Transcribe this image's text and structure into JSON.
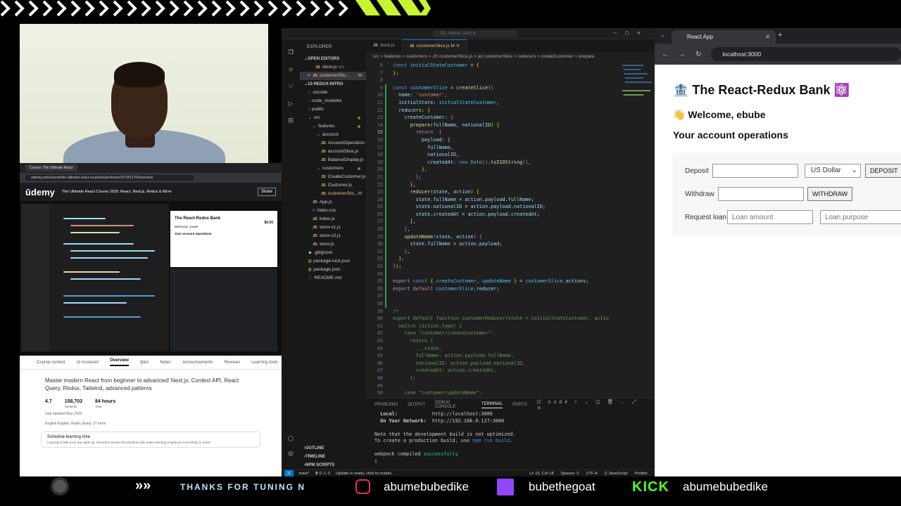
{
  "stream": {
    "ticker": "THANKS FOR TUNING",
    "ticker_tail": "N",
    "instagram": "abumebubedike",
    "twitch": "bubethegoat",
    "kick_label": "KICK",
    "kick": "abumebubedike"
  },
  "udemy": {
    "tab_title": "Course: The Ultimate React",
    "url": "udemy.com/course/the-ultimate-react-course/learn/lecture/37351170#overview",
    "logo": "ūdemy",
    "course_title": "The Ultimate React Course 2025: React, Next.js, Redux & More",
    "share": "Share",
    "mini_app_title": "The React-Redux Bank",
    "mini_app_amount": "$0.00",
    "mini_welcome": "Welcome, Jonas",
    "mini_ops": "Your account operations",
    "tabs": [
      "Course content",
      "AI Assistant",
      "Overview",
      "Q&A",
      "Notes",
      "Announcements",
      "Reviews",
      "Learning tools"
    ],
    "description": "Master modern React from beginner to advanced! Next.js, Context API, React Query, Redux, Tailwind, advanced patterns",
    "rating": "4.7",
    "students": "158,703",
    "students_label": "Students",
    "hours": "84 hours",
    "hours_label": "Total",
    "updated": "Last updated May 2025",
    "lang": "English   English, Arabic [Auto], 27 more",
    "schedule_title": "Schedule learning time",
    "schedule_text": "Learning a little each day adds up. Research shows that students who make learning a habit are more likely to reach"
  },
  "vscode": {
    "search": "15-redux-intro",
    "explorer_title": "EXPLORER",
    "open_editors": "OPEN EDITORS",
    "project": "15-REDUX-INTRO",
    "open_files": [
      {
        "name": "store.js",
        "hint": "src"
      },
      {
        "name": "customerSlic...",
        "hint": "M"
      }
    ],
    "tree": [
      {
        "name": ".vscode",
        "type": "folder",
        "indent": 1
      },
      {
        "name": "node_modules",
        "type": "folder",
        "indent": 1
      },
      {
        "name": "public",
        "type": "folder",
        "indent": 1
      },
      {
        "name": "src",
        "type": "folder-open",
        "indent": 1
      },
      {
        "name": "features",
        "type": "folder-open",
        "indent": 2
      },
      {
        "name": "account",
        "type": "folder-open",
        "indent": 3
      },
      {
        "name": "AccountOperation...",
        "type": "js",
        "indent": 4
      },
      {
        "name": "accountSlice.js",
        "type": "js",
        "indent": 4
      },
      {
        "name": "BalanceDisplay.js",
        "type": "js",
        "indent": 4
      },
      {
        "name": "customers",
        "type": "folder-open",
        "indent": 3
      },
      {
        "name": "CreateCustomer.js",
        "type": "js",
        "indent": 4
      },
      {
        "name": "Customer.js",
        "type": "js",
        "indent": 4
      },
      {
        "name": "customerSlic...",
        "type": "js",
        "indent": 4,
        "badge": "M"
      },
      {
        "name": "App.js",
        "type": "js",
        "indent": 2
      },
      {
        "name": "index.css",
        "type": "css",
        "indent": 2
      },
      {
        "name": "index.js",
        "type": "js",
        "indent": 2
      },
      {
        "name": "store-v1.js",
        "type": "js",
        "indent": 2
      },
      {
        "name": "store-v2.js",
        "type": "js",
        "indent": 2
      },
      {
        "name": "store.js",
        "type": "js",
        "indent": 2
      },
      {
        "name": ".gitignore",
        "type": "file",
        "indent": 1
      },
      {
        "name": "package-lock.json",
        "type": "json",
        "indent": 1
      },
      {
        "name": "package.json",
        "type": "json",
        "indent": 1
      },
      {
        "name": "README.md",
        "type": "md",
        "indent": 1
      }
    ],
    "outline": "OUTLINE",
    "timeline": "TIMELINE",
    "npm": "NPM SCRIPTS",
    "tabs": [
      {
        "name": "store.js",
        "active": false
      },
      {
        "name": "customerSlice.js M",
        "active": true
      }
    ],
    "breadcrumb": "src > features > customers > JS customerSlice.js > [e] customerSlice > reducers > createCustomer > prepare",
    "panel_tabs": [
      "PROBLEMS",
      "OUTPUT",
      "DEBUG CONSOLE",
      "TERMINAL",
      "PORTS"
    ],
    "panel_active": "TERMINAL",
    "terminal": {
      "local_label": "  Local:",
      "local_url": "http://localhost:3000",
      "network_label": "  On Your Network:",
      "network_url": "http://192.168.0.127:3000",
      "note1": "Note that the development build is not optimized.",
      "note2_a": "To create a production build, use ",
      "note2_b": "npm run build",
      "note2_c": ".",
      "compiled_a": "webpack compiled ",
      "compiled_b": "successfully"
    },
    "status": {
      "branch": "main*",
      "errors": "⊗ 0 ⚠ 0",
      "message": "Update is ready, click to restart.",
      "position": "Ln 15, Col 18",
      "spaces": "Spaces: 2",
      "encoding": "UTF-8",
      "lang": "{} JavaScript",
      "prettier": "Prettier"
    }
  },
  "browser": {
    "tab_title": "React App",
    "url": "localhost:3000",
    "title": "🏦 The React-Redux Bank ⚛️",
    "welcome": "👋 Welcome, ebube",
    "ops_title": "Your account operations",
    "deposit_label": "Deposit",
    "currency": "US Dollar",
    "deposit_button": "DEPOSIT",
    "withdraw_label": "Withdraw",
    "withdraw_button": "WITHDRAW",
    "loan_label": "Request loan",
    "loan_amount_placeholder": "Loan amount",
    "loan_purpose_placeholder": "Loan purpose"
  }
}
